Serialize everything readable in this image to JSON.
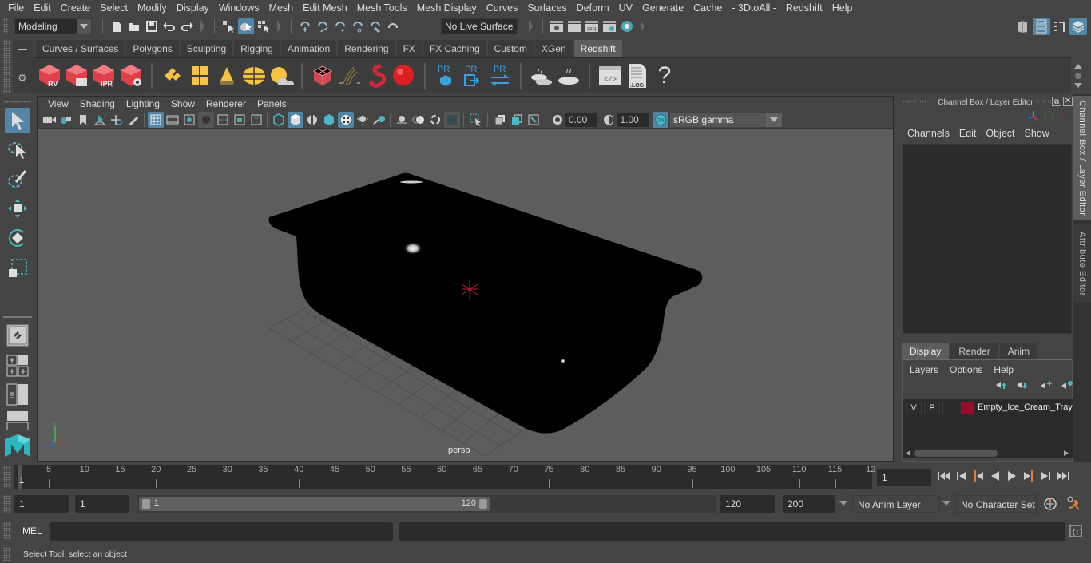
{
  "menubar": {
    "items": [
      "File",
      "Edit",
      "Create",
      "Select",
      "Modify",
      "Display",
      "Windows",
      "Mesh",
      "Edit Mesh",
      "Mesh Tools",
      "Mesh Display",
      "Curves",
      "Surfaces",
      "Deform",
      "UV",
      "Generate",
      "Cache",
      "- 3DtoAll -",
      "Redshift",
      "Help"
    ]
  },
  "statusline": {
    "workspace_mode": "Modeling",
    "live_surface": "No Live Surface"
  },
  "shelf": {
    "tabs": [
      "Curves / Surfaces",
      "Polygons",
      "Sculpting",
      "Rigging",
      "Animation",
      "Rendering",
      "FX",
      "FX Caching",
      "Custom",
      "XGen",
      "Redshift"
    ],
    "active_tab": "Redshift",
    "icons": [
      {
        "name": "redshift-renderview-icon",
        "label": "RV"
      },
      {
        "name": "redshift-batch-render-icon",
        "label": ""
      },
      {
        "name": "redshift-ipr-icon",
        "label": "IPR"
      },
      {
        "name": "redshift-render-settings-icon",
        "label": ""
      },
      {
        "name": "rs-area-light-icon",
        "label": ""
      },
      {
        "name": "rs-portal-light-icon",
        "label": ""
      },
      {
        "name": "rs-spot-light-icon",
        "label": ""
      },
      {
        "name": "rs-dome-light-icon",
        "label": ""
      },
      {
        "name": "rs-sun-sky-icon",
        "label": ""
      },
      {
        "name": "rs-volume-icon",
        "label": ""
      },
      {
        "name": "rs-hair-icon",
        "label": ""
      },
      {
        "name": "rs-mesh-light-icon",
        "label": ""
      },
      {
        "name": "rs-sphere-icon",
        "label": ""
      },
      {
        "name": "rs-proxy-icon",
        "label": "PR"
      },
      {
        "name": "rs-proxy-export-icon",
        "label": "PR"
      },
      {
        "name": "rs-proxy-swap-icon",
        "label": "PR"
      },
      {
        "name": "rs-bake-set-icon",
        "label": ""
      },
      {
        "name": "rs-bake-icon",
        "label": ""
      },
      {
        "name": "rs-script-editor-icon",
        "label": ""
      },
      {
        "name": "rs-log-icon",
        "label": ".LOG"
      },
      {
        "name": "rs-help-icon",
        "label": "?"
      }
    ]
  },
  "viewport": {
    "menus": [
      "View",
      "Shading",
      "Lighting",
      "Show",
      "Renderer",
      "Panels"
    ],
    "exposure": "0.00",
    "gamma": "1.00",
    "color_management_toggle": "ON",
    "color_space": "sRGB gamma",
    "camera_label": "persp"
  },
  "channel_box": {
    "title": "Channel Box / Layer Editor",
    "menus": [
      "Channels",
      "Edit",
      "Object",
      "Show"
    ]
  },
  "layer_editor": {
    "tabs": [
      "Display",
      "Render",
      "Anim"
    ],
    "active_tab": "Display",
    "menus": [
      "Layers",
      "Options",
      "Help"
    ],
    "layers": [
      {
        "visible": "V",
        "playback": "P",
        "color": "#9b0c2a",
        "name": "Empty_Ice_Cream_Tray"
      }
    ]
  },
  "side_tabs": [
    "Channel Box / Layer Editor",
    "Attribute Editor"
  ],
  "time_slider": {
    "ticks": [
      "5",
      "10",
      "15",
      "20",
      "25",
      "30",
      "35",
      "40",
      "45",
      "50",
      "55",
      "60",
      "65",
      "70",
      "75",
      "80",
      "85",
      "90",
      "95",
      "100",
      "105",
      "110",
      "115",
      "12"
    ],
    "current_frame_marker": "1",
    "current_frame": "1"
  },
  "range": {
    "start": "1",
    "playback_start": "1",
    "slider_start": "1",
    "slider_end": "120",
    "playback_end": "120",
    "end": "200",
    "anim_layer": "No Anim Layer",
    "character_set": "No Character Set"
  },
  "command_line": {
    "label": "MEL",
    "value": ""
  },
  "help_line": {
    "text": "Select Tool: select an object"
  }
}
